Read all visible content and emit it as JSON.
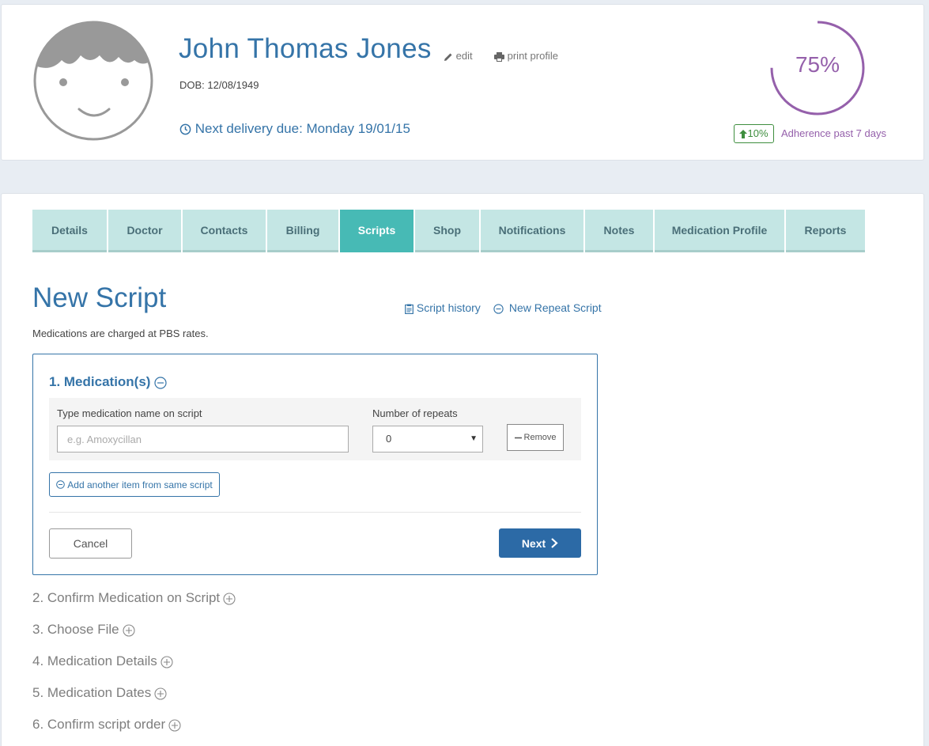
{
  "profile": {
    "name": "John Thomas Jones",
    "edit_label": "edit",
    "print_label": "print profile",
    "dob": "DOB: 12/08/1949",
    "next_delivery": "Next delivery due: Monday 19/01/15",
    "adherence": {
      "percent_text": "75%",
      "fraction": 0.75,
      "change": "10%",
      "label": "Adherence past 7 days",
      "ring_color": "#9560ab",
      "badge_color": "#3e8e3e"
    }
  },
  "tabs": [
    {
      "label": "Details",
      "active": false
    },
    {
      "label": "Doctor",
      "active": false
    },
    {
      "label": "Contacts",
      "active": false
    },
    {
      "label": "Billing",
      "active": false
    },
    {
      "label": "Scripts",
      "active": true
    },
    {
      "label": "Shop",
      "active": false
    },
    {
      "label": "Notifications",
      "active": false
    },
    {
      "label": "Notes",
      "active": false
    },
    {
      "label": "Medication Profile",
      "active": false
    },
    {
      "label": "Reports",
      "active": false
    }
  ],
  "page": {
    "title": "New Script",
    "script_history": "Script history",
    "new_repeat": "New Repeat Script",
    "pbs_note": "Medications are charged at PBS rates."
  },
  "medication_section": {
    "heading": "1. Medication(s)",
    "name_label": "Type medication name on script",
    "name_value": "",
    "name_placeholder": "e.g. Amoxycillan",
    "repeats_label": "Number of repeats",
    "repeats_value": "0",
    "remove_label": "Remove",
    "add_item_label": "Add another item from same script",
    "cancel_label": "Cancel",
    "next_label": "Next"
  },
  "steps": [
    "2. Confirm Medication on Script",
    "3. Choose File",
    "4. Medication Details",
    "5. Medication Dates",
    "6. Confirm script order"
  ],
  "colors": {
    "primary": "#3574a8",
    "tab_active": "#47bab5",
    "tab_inactive": "#c4e6e4",
    "next_button": "#2c6aa6"
  }
}
